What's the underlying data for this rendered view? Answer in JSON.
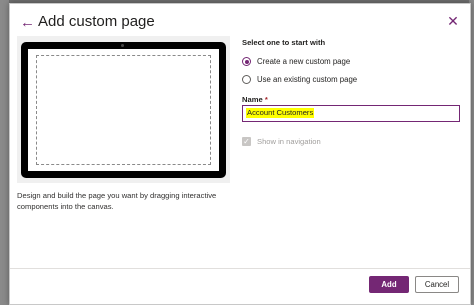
{
  "dialog": {
    "title": "Add custom page",
    "back_icon": "arrow-left-icon",
    "close_icon": "close-icon"
  },
  "preview": {
    "description": "Design and build the page you want by dragging interactive components into the canvas."
  },
  "options": {
    "section_label": "Select one to start with",
    "items": [
      {
        "label": "Create a new custom page",
        "selected": true
      },
      {
        "label": "Use an existing custom page",
        "selected": false
      }
    ]
  },
  "name_field": {
    "label": "Name",
    "required_marker": "*",
    "value": "Account Customers"
  },
  "navigation_checkbox": {
    "label": "Show in navigation",
    "checked": true,
    "disabled": true
  },
  "footer": {
    "add_label": "Add",
    "cancel_label": "Cancel"
  },
  "colors": {
    "accent": "#742774",
    "highlight": "#ffff00"
  }
}
